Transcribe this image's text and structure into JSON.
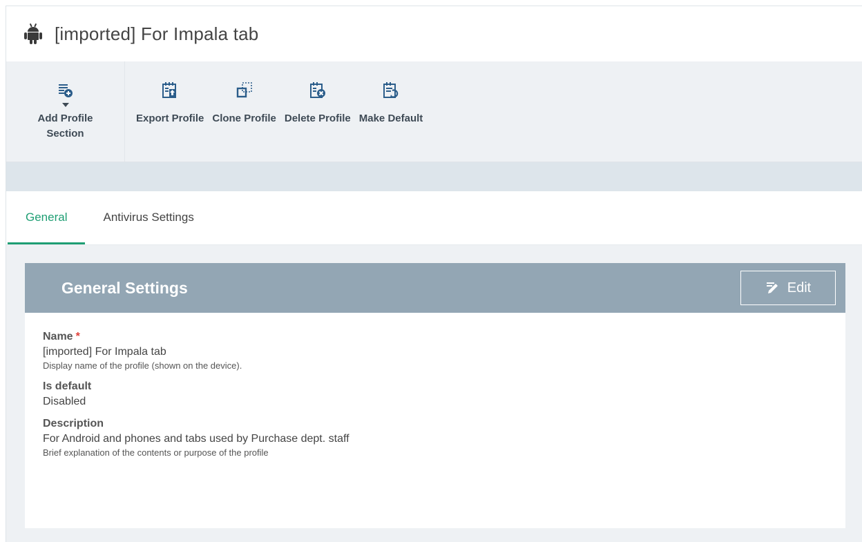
{
  "header": {
    "title": "[imported] For Impala tab",
    "icon": "android-icon"
  },
  "toolbar": {
    "add_profile_section": "Add Profile Section",
    "buttons": [
      {
        "label": "Export Profile",
        "icon": "export-icon"
      },
      {
        "label": "Clone Profile",
        "icon": "clone-icon"
      },
      {
        "label": "Delete Profile",
        "icon": "delete-icon"
      },
      {
        "label": "Make Default",
        "icon": "make-default-icon"
      }
    ]
  },
  "tabs": [
    {
      "label": "General",
      "active": true
    },
    {
      "label": "Antivirus Settings",
      "active": false
    }
  ],
  "panel": {
    "title": "General Settings",
    "edit_label": "Edit",
    "fields": {
      "name": {
        "label": "Name",
        "required_mark": "*",
        "value": "[imported] For Impala tab",
        "hint": "Display name of the profile (shown on the device)."
      },
      "is_default": {
        "label": "Is default",
        "value": "Disabled"
      },
      "description": {
        "label": "Description",
        "value": "For Android and phones and tabs used by Purchase dept. staff",
        "hint": "Brief explanation of the contents or purpose of the profile"
      }
    }
  },
  "colors": {
    "accent": "#1e9e73",
    "panel_header": "#93a6b4",
    "toolbar_icon": "#2b5d8a",
    "required": "#e0403a"
  }
}
